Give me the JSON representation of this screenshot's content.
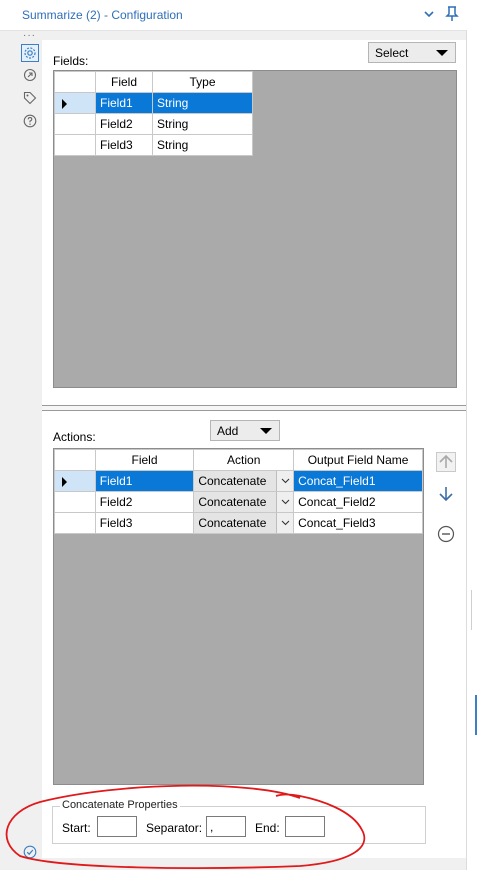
{
  "window": {
    "title": "Summarize (2) - Configuration"
  },
  "sidebar": {
    "overflow": "···"
  },
  "fields": {
    "label": "Fields:",
    "select_label": "Select",
    "columns": [
      "Field",
      "Type"
    ],
    "rows": [
      {
        "field": "Field1",
        "type": "String"
      },
      {
        "field": "Field2",
        "type": "String"
      },
      {
        "field": "Field3",
        "type": "String"
      }
    ]
  },
  "actions": {
    "label": "Actions:",
    "add_label": "Add",
    "columns": [
      "Field",
      "Action",
      "Output Field Name"
    ],
    "rows": [
      {
        "field": "Field1",
        "action": "Concatenate",
        "output": "Concat_Field1"
      },
      {
        "field": "Field2",
        "action": "Concatenate",
        "output": "Concat_Field2"
      },
      {
        "field": "Field3",
        "action": "Concatenate",
        "output": "Concat_Field3"
      }
    ]
  },
  "concat": {
    "title": "Concatenate Properties",
    "start_label": "Start:",
    "start_value": "",
    "separator_label": "Separator:",
    "separator_value": ",",
    "end_label": "End:",
    "end_value": ""
  },
  "colors": {
    "accent": "#0a78d7",
    "title": "#2f6fb8",
    "grid_bg": "#aaaaaa",
    "annotation": "#e0191b"
  }
}
